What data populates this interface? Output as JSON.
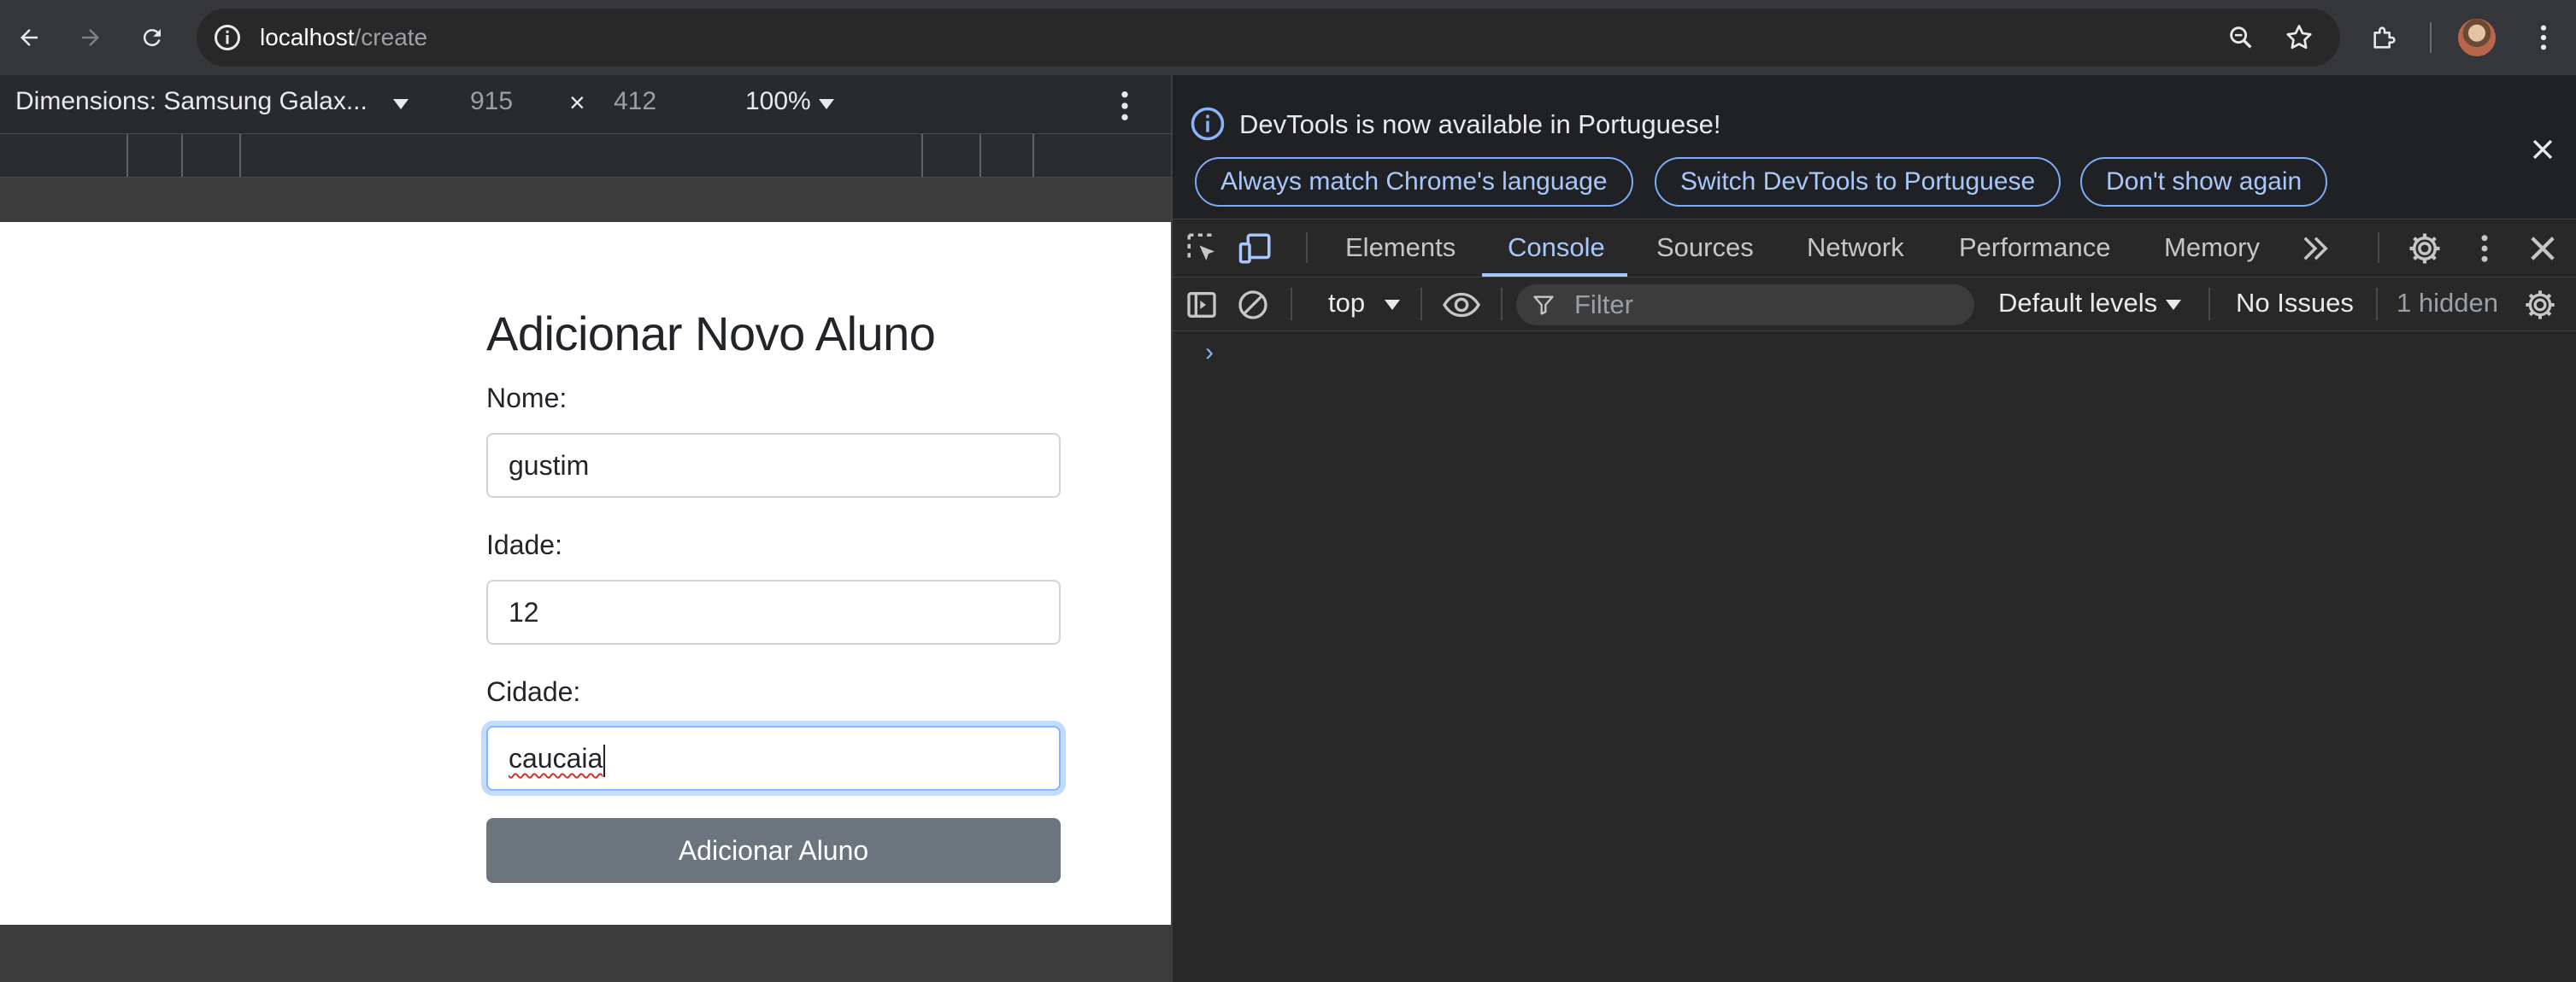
{
  "browser": {
    "url_host": "localhost",
    "url_path": "/create"
  },
  "device_toolbar": {
    "device": "Dimensions: Samsung Galax...",
    "width": "915",
    "separator": "×",
    "height": "412",
    "zoom": "100%"
  },
  "page": {
    "title": "Adicionar Novo Aluno",
    "fields": [
      {
        "label": "Nome:",
        "value": "gustim"
      },
      {
        "label": "Idade:",
        "value": "12"
      },
      {
        "label": "Cidade:",
        "value": "caucaia"
      }
    ],
    "submit_label": "Adicionar Aluno",
    "submit_color": "#6c757d"
  },
  "devtools": {
    "info_message": "DevTools is now available in Portuguese!",
    "info_buttons": [
      "Always match Chrome's language",
      "Switch DevTools to Portuguese",
      "Don't show again"
    ],
    "tabs": [
      "Elements",
      "Console",
      "Sources",
      "Network",
      "Performance",
      "Memory"
    ],
    "active_tab": "Console",
    "console": {
      "context": "top",
      "filter_placeholder": "Filter",
      "levels": "Default levels",
      "issues": "No Issues",
      "hidden": "1 hidden",
      "prompt": "›"
    },
    "accent_color": "#a8c7fa"
  }
}
